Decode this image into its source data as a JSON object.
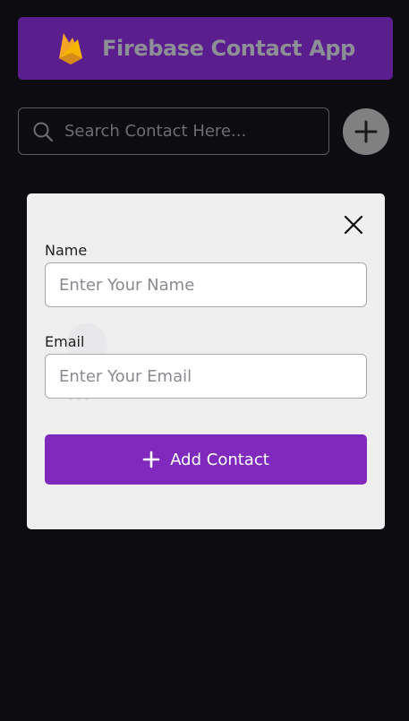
{
  "header": {
    "title": "Firebase Contact App",
    "logo_icon": "firebase-flame-icon",
    "background": "#5b1e8e"
  },
  "search": {
    "placeholder": "Search Contact Here...",
    "value": "",
    "icon": "search-icon"
  },
  "fab": {
    "icon": "plus-icon",
    "color": "#808080"
  },
  "modal": {
    "close_icon": "close-icon",
    "name_label": "Name",
    "name_placeholder": "Enter Your Name",
    "email_label": "Email",
    "email_placeholder": "Enter Your Email",
    "submit_label": "Add Contact",
    "submit_color": "#7f2abc"
  }
}
